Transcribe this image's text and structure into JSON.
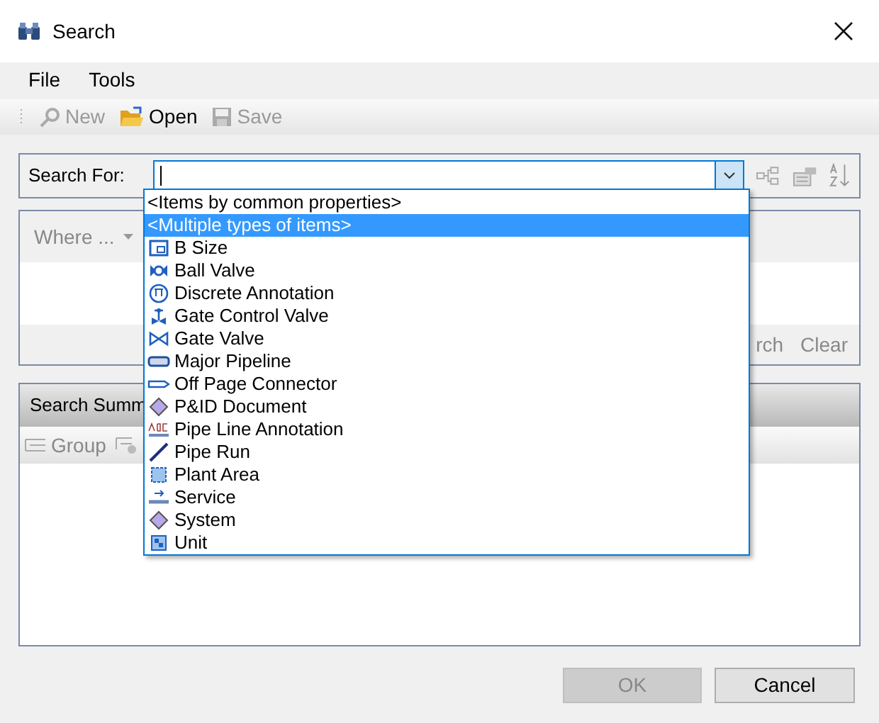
{
  "window": {
    "title": "Search"
  },
  "menu": [
    "File",
    "Tools"
  ],
  "toolbar": [
    {
      "label": "New",
      "disabled": true
    },
    {
      "label": "Open",
      "disabled": false
    },
    {
      "label": "Save",
      "disabled": true
    }
  ],
  "search_for": {
    "label": "Search For:"
  },
  "dropdown_items": [
    {
      "label": "<Items by common properties>",
      "kind": "heading",
      "selected": false
    },
    {
      "label": "<Multiple types of items>",
      "kind": "heading",
      "selected": true
    },
    {
      "label": "B Size",
      "kind": "type",
      "selected": false
    },
    {
      "label": "Ball Valve",
      "kind": "type",
      "selected": false
    },
    {
      "label": "Discrete Annotation",
      "kind": "type",
      "selected": false
    },
    {
      "label": "Gate Control Valve",
      "kind": "type",
      "selected": false
    },
    {
      "label": "Gate Valve",
      "kind": "type",
      "selected": false
    },
    {
      "label": "Major Pipeline",
      "kind": "type",
      "selected": false
    },
    {
      "label": "Off Page Connector",
      "kind": "type",
      "selected": false
    },
    {
      "label": "P&ID Document",
      "kind": "type",
      "selected": false
    },
    {
      "label": "Pipe Line Annotation",
      "kind": "type",
      "selected": false
    },
    {
      "label": "Pipe Run",
      "kind": "type",
      "selected": false
    },
    {
      "label": "Plant Area",
      "kind": "type",
      "selected": false
    },
    {
      "label": "Service",
      "kind": "type",
      "selected": false
    },
    {
      "label": "System",
      "kind": "type",
      "selected": false
    },
    {
      "label": "Unit",
      "kind": "type",
      "selected": false
    }
  ],
  "where_panel": {
    "header": "Where ...",
    "buttons": [
      "rch",
      "Clear"
    ]
  },
  "summary_panel": {
    "header": "Search Summ",
    "toolbar": [
      "Group"
    ]
  },
  "dialog_buttons": [
    {
      "label": "OK",
      "disabled": true
    },
    {
      "label": "Cancel",
      "disabled": false
    }
  ]
}
